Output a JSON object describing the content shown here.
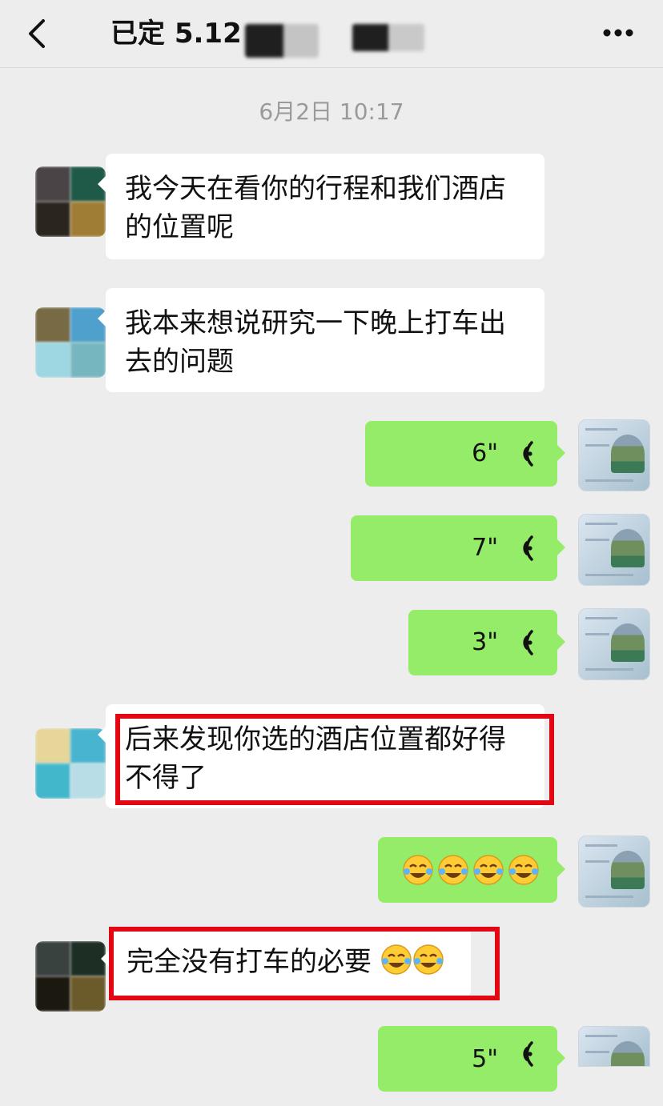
{
  "header": {
    "title": "已定 5.12"
  },
  "timestamp": "6月2日 10:17",
  "messages": [
    {
      "text": "我今天在看你的行程和我们酒店的位置呢"
    },
    {
      "text": "我本来想说研究一下晚上打车出去的问题"
    },
    {
      "duration": "6\""
    },
    {
      "duration": "7\""
    },
    {
      "duration": "3\""
    },
    {
      "text": "后来发现你选的酒店位置都好得不得了"
    },
    {
      "emoji": "😂😂😂😂"
    },
    {
      "text": "完全没有打车的必要"
    },
    {
      "duration": "5\""
    }
  ],
  "colors": {
    "incoming": "#ffffff",
    "outgoing": "#95ec69",
    "highlight": "#e30613",
    "background": "#ededed"
  },
  "icons": {
    "back": "chevron-left-icon",
    "more": "more-dots-icon",
    "voice": "voice-wave-icon",
    "emoji": "laughing-crying-emoji"
  }
}
